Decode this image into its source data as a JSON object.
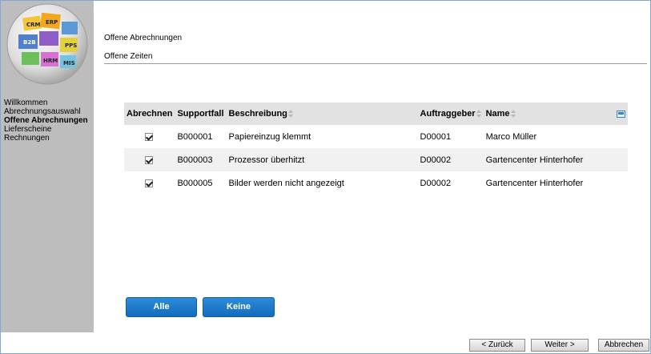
{
  "sidebar": {
    "logo_labels": [
      "CRM",
      "ERP",
      "B2B",
      "PPS",
      "HRM",
      "MIS"
    ],
    "items": [
      {
        "label": "Willkommen",
        "active": false
      },
      {
        "label": "Abrechnungsauswahl",
        "active": false
      },
      {
        "label": "Offene Abrechnungen",
        "active": true
      },
      {
        "label": "Lieferscheine",
        "active": false
      },
      {
        "label": "Rechnungen",
        "active": false
      }
    ]
  },
  "tabs": {
    "open_invoices": "Offene Abrechnungen",
    "open_times": "Offene Zeiten"
  },
  "table": {
    "headers": {
      "abrechnen": "Abrechnen",
      "supportfall": "Supportfall",
      "beschreibung": "Beschreibung",
      "auftraggeber": "Auftraggeber",
      "name": "Name"
    },
    "rows": [
      {
        "checked": true,
        "supportfall": "B000001",
        "beschreibung": "Papiereinzug klemmt",
        "auftraggeber": "D00001",
        "name": "Marco Müller"
      },
      {
        "checked": true,
        "supportfall": "B000003",
        "beschreibung": "Prozessor überhitzt",
        "auftraggeber": "D00002",
        "name": "Gartencenter Hinterhofer"
      },
      {
        "checked": true,
        "supportfall": "B000005",
        "beschreibung": "Bilder werden nicht angezeigt",
        "auftraggeber": "D00002",
        "name": "Gartencenter Hinterhofer"
      }
    ]
  },
  "buttons": {
    "alle": "Alle",
    "keine": "Keine",
    "zurueck": "< Zurück",
    "weiter": "Weiter >",
    "abbrechen": "Abbrechen"
  },
  "colors": {
    "sidebar_bg": "#bdbdbd",
    "primary_button": "#1a7acb",
    "header_bg": "#e2e2e2"
  }
}
